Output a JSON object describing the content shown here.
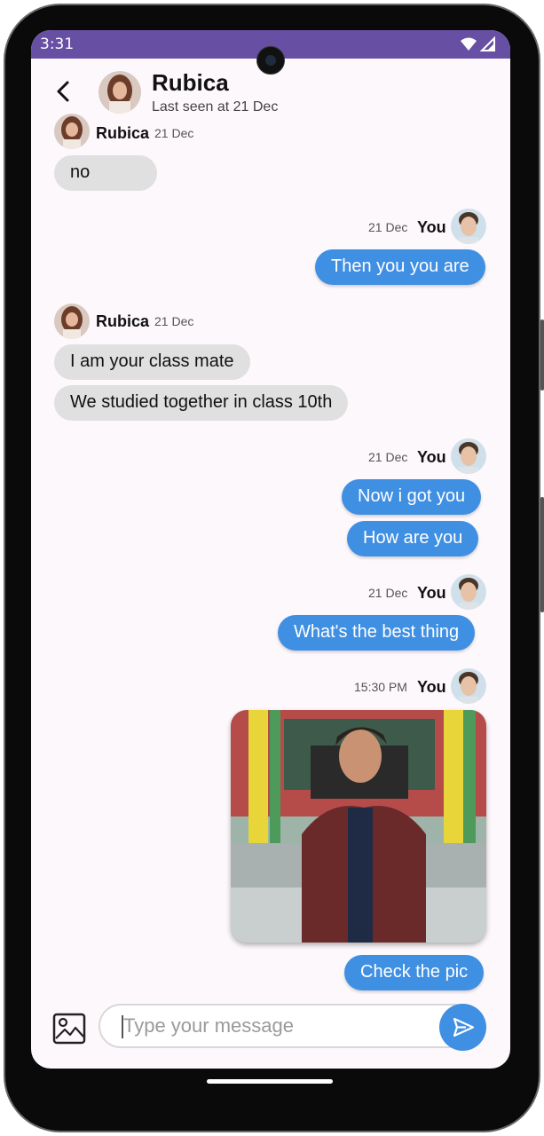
{
  "status": {
    "time": "3:31",
    "color": "#6750a4"
  },
  "header": {
    "name": "Rubica",
    "last_seen": "Last seen at 21 Dec"
  },
  "messages": {
    "m1": {
      "sender": "Rubica",
      "time": "21 Dec",
      "text": "no"
    },
    "m2": {
      "sender": "You",
      "time": "21 Dec",
      "text": "Then you you are"
    },
    "m3": {
      "sender": "Rubica",
      "time": "21 Dec",
      "text1": "I am your class mate",
      "text2": "We studied together in class 10th"
    },
    "m4": {
      "sender": "You",
      "time": "21 Dec",
      "text1": "Now i got you",
      "text2": "How are you"
    },
    "m5": {
      "sender": "You",
      "time": "21 Dec",
      "text": "What's the best thing"
    },
    "m6": {
      "sender": "You",
      "time": "15:30 PM",
      "photo": "photo-of-man-in-maroon-jacket",
      "text": "Check the pic"
    }
  },
  "composer": {
    "placeholder": "Type your message"
  },
  "colors": {
    "outgoing": "#3f8fe3",
    "incoming": "#e0e0e0",
    "background": "#fdf8fc"
  },
  "icons": [
    "back-arrow-icon",
    "gallery-icon",
    "send-icon",
    "wifi-icon",
    "signal-icon"
  ]
}
